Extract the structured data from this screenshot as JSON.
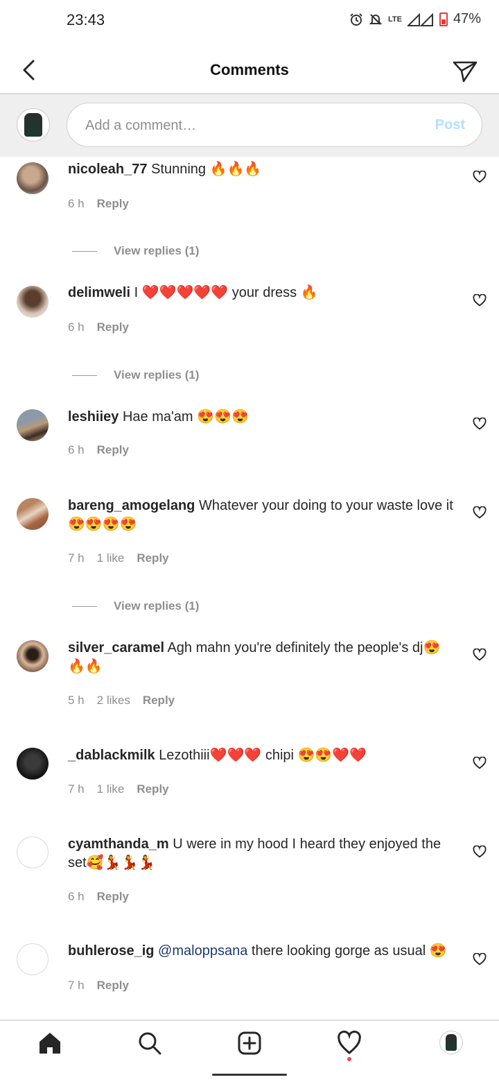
{
  "status": {
    "time": "23:43",
    "network": "LTE",
    "battery": "47%"
  },
  "header": {
    "title": "Comments"
  },
  "composer": {
    "placeholder": "Add a comment…",
    "post_label": "Post"
  },
  "comments": [
    {
      "user": "nicoleah_77",
      "text": "Stunning 🔥🔥🔥",
      "time": "6 h",
      "likes": "",
      "reply": "Reply",
      "view_replies": "View replies (1)"
    },
    {
      "user": "delimweli",
      "text": "I ❤️❤️❤️❤️❤️ your dress 🔥",
      "time": "6 h",
      "likes": "",
      "reply": "Reply",
      "view_replies": "View replies (1)"
    },
    {
      "user": "leshiiey",
      "text": "Hae ma'am 😍😍😍",
      "time": "6 h",
      "likes": "",
      "reply": "Reply",
      "view_replies": ""
    },
    {
      "user": "bareng_amogelang",
      "text": "Whatever your doing to your waste love it 😍😍😍😍",
      "time": "7 h",
      "likes": "1 like",
      "reply": "Reply",
      "view_replies": "View replies (1)"
    },
    {
      "user": "silver_caramel",
      "text": "Agh mahn you're definitely the people's dj😍🔥🔥",
      "time": "5 h",
      "likes": "2 likes",
      "reply": "Reply",
      "view_replies": ""
    },
    {
      "user": "_dablackmilk",
      "text": "Lezothiii❤️❤️❤️ chipi 😍😍❤️❤️",
      "time": "7 h",
      "likes": "1 like",
      "reply": "Reply",
      "view_replies": ""
    },
    {
      "user": "cyamthanda_m",
      "text": "U were in my hood I heard they enjoyed the set🥰💃💃💃",
      "time": "6 h",
      "likes": "",
      "reply": "Reply",
      "view_replies": ""
    },
    {
      "user": "buhlerose_ig",
      "mention": "@maloppsana",
      "text": "there looking gorge as usual 😍",
      "time": "7 h",
      "likes": "",
      "reply": "Reply",
      "view_replies": ""
    }
  ],
  "icons": {
    "back": "chevron-left-icon",
    "send": "paper-plane-icon",
    "heart": "heart-outline-icon",
    "nav_home": "home-icon",
    "nav_search": "search-icon",
    "nav_add": "add-post-icon",
    "nav_activity": "heart-icon"
  },
  "colors": {
    "post_disabled": "#b2dffc",
    "mention": "#1e3a6e",
    "notification_dot": "#ed4956",
    "battery": "#e53935"
  }
}
